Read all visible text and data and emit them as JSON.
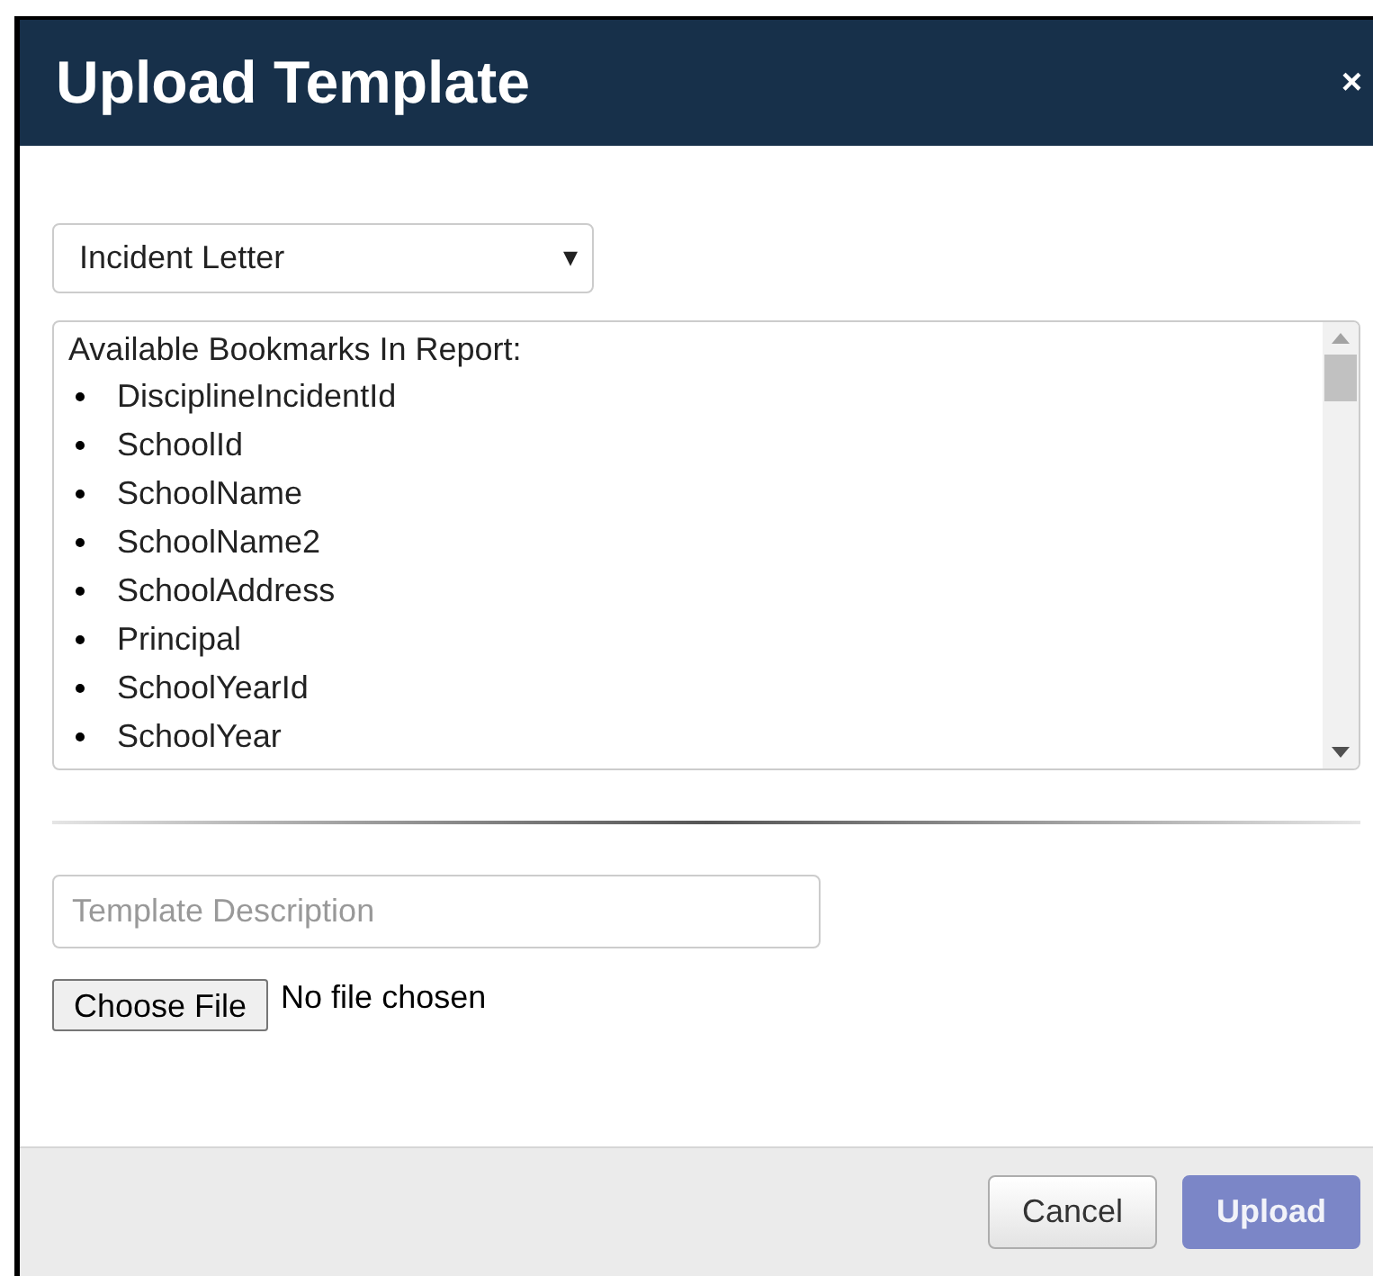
{
  "dialog": {
    "title": "Upload Template",
    "close": "×"
  },
  "template_select": {
    "value": "Incident Letter",
    "caret": "▾"
  },
  "bookmarks": {
    "heading": "Available Bookmarks In Report:",
    "items": [
      "DisciplineIncidentId",
      "SchoolId",
      "SchoolName",
      "SchoolName2",
      "SchoolAddress",
      "Principal",
      "SchoolYearId",
      "SchoolYear"
    ]
  },
  "description": {
    "placeholder": "Template Description"
  },
  "file": {
    "button": "Choose File",
    "status": "No file chosen"
  },
  "buttons": [
    {
      "label": "Cancel",
      "kind": "secondary",
      "disabled": false
    },
    {
      "label": "Upload",
      "kind": "primary",
      "disabled": true
    }
  ]
}
